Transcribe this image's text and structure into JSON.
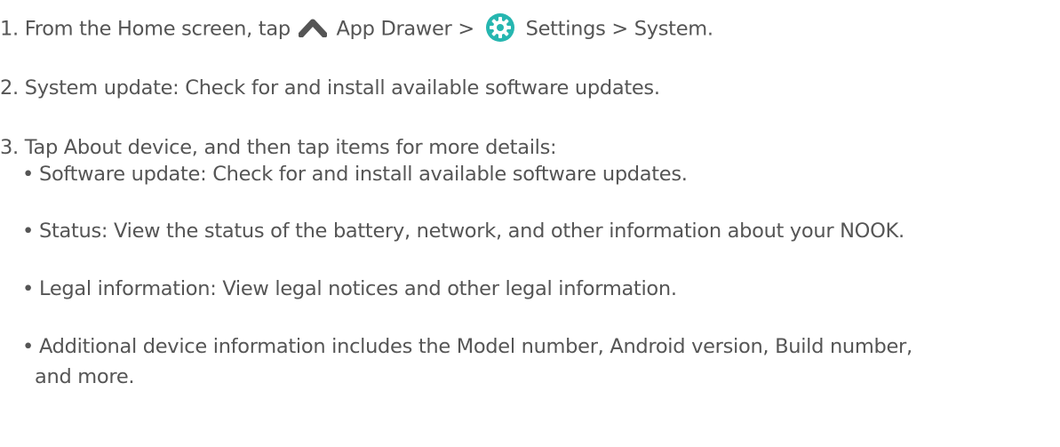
{
  "steps": [
    {
      "number": "1.",
      "segments": {
        "part1": "From the Home screen, tap",
        "app_drawer": "App Drawer >",
        "settings": "Settings > System."
      }
    },
    {
      "number": "2.",
      "text": "System update: Check for and install available software updates."
    },
    {
      "number": "3.",
      "text": "Tap About device, and then tap items for more details:"
    }
  ],
  "bullets": [
    "Software update: Check for and install available software updates.",
    "Status: View the status of the battery, network, and other information about your NOOK.",
    "Legal information: View legal notices and other legal information.",
    "Additional device information includes the Model number, Android version, Build number,"
  ],
  "bullet_continuation": "and more.",
  "bullet_symbol": "•",
  "icons": {
    "app_drawer": "chevron-up-icon",
    "settings": "gear-icon"
  },
  "colors": {
    "text": "#555555",
    "accent": "#26b6b0"
  }
}
